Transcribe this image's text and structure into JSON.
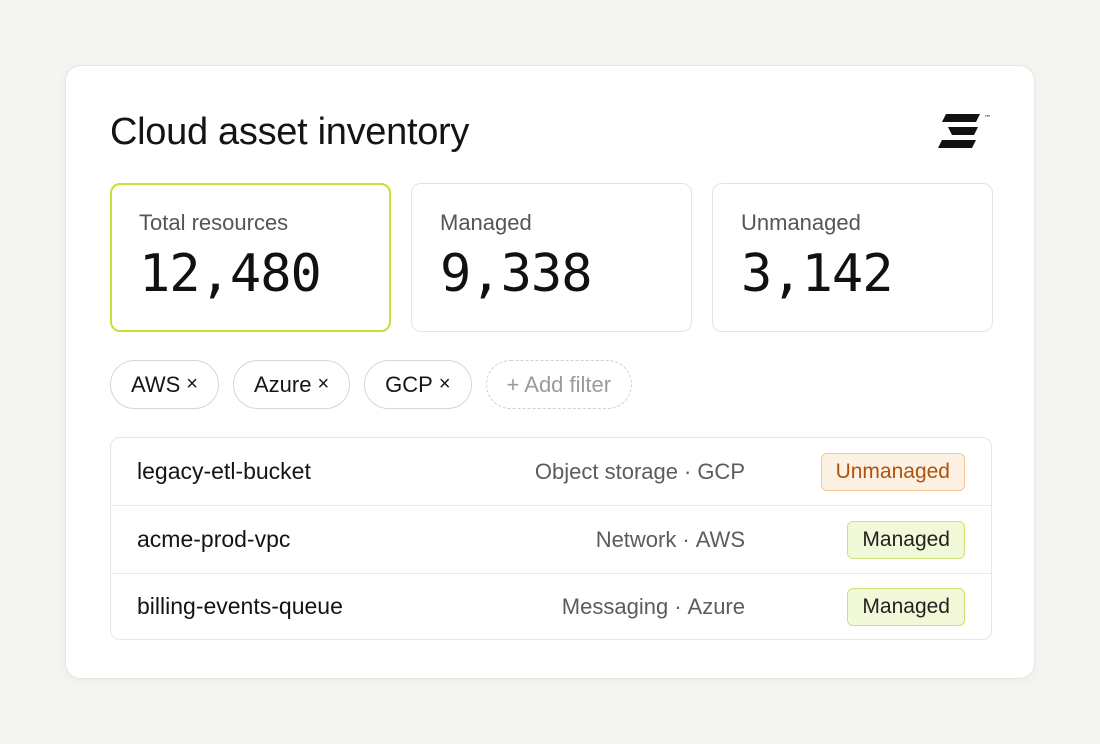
{
  "header": {
    "title": "Cloud asset inventory",
    "logo_icon": "stacked-bars-logo-icon",
    "logo_mark": "™"
  },
  "stats": [
    {
      "label": "Total resources",
      "value": "12,480",
      "active": true
    },
    {
      "label": "Managed",
      "value": "9,338",
      "active": false
    },
    {
      "label": "Unmanaged",
      "value": "3,142",
      "active": false
    }
  ],
  "filters": {
    "chips": [
      {
        "label": "AWS",
        "remove": "×"
      },
      {
        "label": "Azure",
        "remove": "×"
      },
      {
        "label": "GCP",
        "remove": "×"
      }
    ],
    "add_label": "+ Add filter"
  },
  "resources": [
    {
      "name": "legacy-etl-bucket",
      "type": "Object storage",
      "sep": "·",
      "provider": "GCP",
      "status": "Unmanaged",
      "status_kind": "unmanaged"
    },
    {
      "name": "acme-prod-vpc",
      "type": "Network",
      "sep": "·",
      "provider": "AWS",
      "status": "Managed",
      "status_kind": "managed"
    },
    {
      "name": "billing-events-queue",
      "type": "Messaging",
      "sep": "·",
      "provider": "Azure",
      "status": "Managed",
      "status_kind": "managed"
    }
  ],
  "colors": {
    "accent": "#c5e03a",
    "unmanaged_text": "#b0520c",
    "unmanaged_bg": "#fdf1e4",
    "managed_bg": "#f1f9d8"
  }
}
